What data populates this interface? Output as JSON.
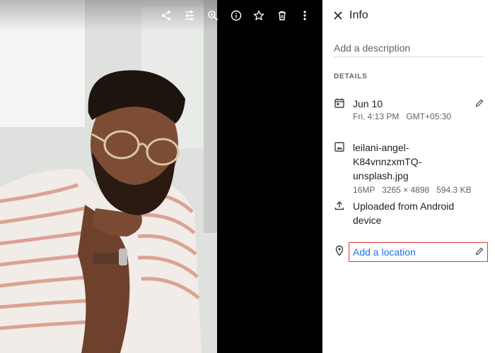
{
  "viewer": {
    "photo_alt": "Man with glasses leaning on his hand",
    "toolbar": [
      "share-icon",
      "edit-icon",
      "zoom-in-icon",
      "info-icon",
      "star-icon",
      "delete-icon",
      "more-vert-icon"
    ]
  },
  "panel": {
    "title": "Info",
    "description_placeholder": "Add a description",
    "details_label": "DETAILS",
    "date": {
      "primary": "Jun 10",
      "secondary": "Fri, 4:13 PM   GMT+05:30"
    },
    "file": {
      "name_line1": "leilani-angel-K84vnnzxmTQ-",
      "name_line2": "unsplash.jpg",
      "meta": "16MP   3265 × 4898   594.3 KB"
    },
    "upload": {
      "line1": "Uploaded from Android",
      "line2": "device"
    },
    "location": {
      "label": "Add a location"
    }
  },
  "colors": {
    "link": "#1a73e8",
    "highlight_box": "#e53935",
    "secondary_text": "#5f6368"
  }
}
